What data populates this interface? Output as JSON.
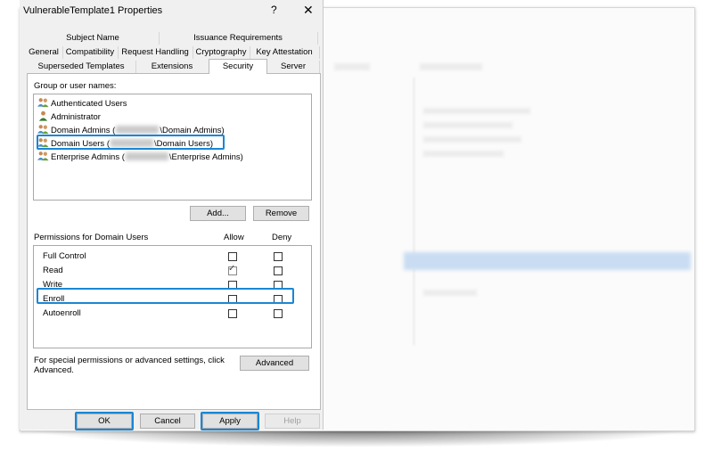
{
  "dialog": {
    "title": "VulnerableTemplate1 Properties",
    "help_glyph": "?",
    "close_glyph": "✕"
  },
  "tabs": {
    "row1": [
      "Subject Name",
      "Issuance Requirements"
    ],
    "row2": [
      "General",
      "Compatibility",
      "Request Handling",
      "Cryptography",
      "Key Attestation"
    ],
    "row3": [
      "Superseded Templates",
      "Extensions",
      "Security",
      "Server"
    ],
    "selected": "Security"
  },
  "security": {
    "group_label": "Group or user names:",
    "users": [
      {
        "name": "Authenticated Users",
        "icon": "group-icon"
      },
      {
        "name": "Administrator",
        "icon": "user-icon"
      },
      {
        "name": "Domain Admins (",
        "suffix": "\\Domain Admins)",
        "icon": "group-icon"
      },
      {
        "name": "Domain Users (",
        "suffix": "\\Domain Users)",
        "icon": "group-icon"
      },
      {
        "name": "Enterprise Admins (",
        "suffix": "\\Enterprise Admins)",
        "icon": "group-icon"
      }
    ],
    "add_button": "Add...",
    "remove_button": "Remove",
    "permissions_label": "Permissions for Domain Users",
    "allow_header": "Allow",
    "deny_header": "Deny",
    "permissions": [
      {
        "name": "Full Control",
        "allow": false,
        "deny": false
      },
      {
        "name": "Read",
        "allow": true,
        "deny": false
      },
      {
        "name": "Write",
        "allow": false,
        "deny": false
      },
      {
        "name": "Enroll",
        "allow": false,
        "deny": false
      },
      {
        "name": "Autoenroll",
        "allow": false,
        "deny": false
      }
    ],
    "special_text_line1": "For special permissions or advanced settings, click",
    "special_text_line2": "Advanced.",
    "advanced_button": "Advanced"
  },
  "footer": {
    "ok": "OK",
    "cancel": "Cancel",
    "apply": "Apply",
    "help": "Help"
  },
  "colors": {
    "highlight": "#1a86d4"
  }
}
